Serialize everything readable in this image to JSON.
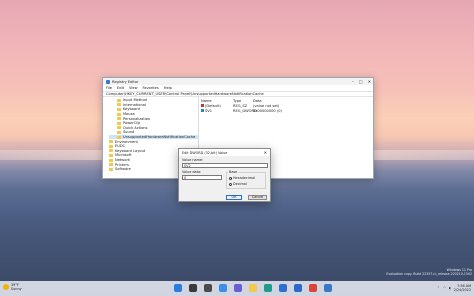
{
  "registry": {
    "title": "Registry Editor",
    "window_buttons": [
      "–",
      "□",
      "✕"
    ],
    "menu": [
      "File",
      "Edit",
      "View",
      "Favorites",
      "Help"
    ],
    "address": "Computer\\HKEY_CURRENT_USER\\Control Panel\\UnsupportedHardwareNotificationCache",
    "tree_sub": [
      "Input Method",
      "International",
      "Keyboard",
      "Mouse",
      "Personalization",
      "PowerCfg",
      "Quick Actions",
      "Sound",
      "UnsupportedHardwareNotificationCache"
    ],
    "tree_top": [
      "Environment",
      "EUDC",
      "Keyboard Layout",
      "Microsoft",
      "Network",
      "Printers",
      "Software"
    ],
    "values_header": {
      "name": "Name",
      "type": "Type",
      "data": "Data"
    },
    "values": [
      {
        "name": "(Default)",
        "type": "REG_SZ",
        "data": "(value not set)"
      },
      {
        "name": "SV1",
        "type": "REG_DWORD",
        "data": "0x00000000 (0)"
      }
    ]
  },
  "dialog": {
    "title": "Edit DWORD (32-bit) Value",
    "close": "✕",
    "value_name_label": "Value name:",
    "value_name": "SV2",
    "value_data_label": "Value data:",
    "value_data": "0",
    "base_label": "Base",
    "base_options": [
      "Hexadecimal",
      "Decimal"
    ],
    "ok": "OK",
    "cancel": "Cancel"
  },
  "watermark": {
    "line1": "Windows 11 Pro",
    "line2": "Evaluation copy. Build 22557.ni_release.220210-1502"
  },
  "taskbar": {
    "temperature": "39°F",
    "weather": "Sunny",
    "time": "7:56 AM",
    "date": "2/24/2022",
    "icons": [
      {
        "name": "start-icon",
        "color": "#2b7de0"
      },
      {
        "name": "search-icon",
        "color": "#3a3a3a"
      },
      {
        "name": "task-view-icon",
        "color": "#4a4a4a"
      },
      {
        "name": "widgets-icon",
        "color": "#3c8ee6"
      },
      {
        "name": "chat-icon",
        "color": "#6b5fd3"
      },
      {
        "name": "file-explorer-icon",
        "color": "#f2c94c"
      },
      {
        "name": "edge-icon",
        "color": "#1e9b8a"
      },
      {
        "name": "store-icon",
        "color": "#2f6fd1"
      },
      {
        "name": "mail-icon",
        "color": "#2a6ac9"
      },
      {
        "name": "chrome-icon",
        "color": "#db4437"
      },
      {
        "name": "registry-editor-icon",
        "color": "#3a78c8"
      }
    ]
  }
}
